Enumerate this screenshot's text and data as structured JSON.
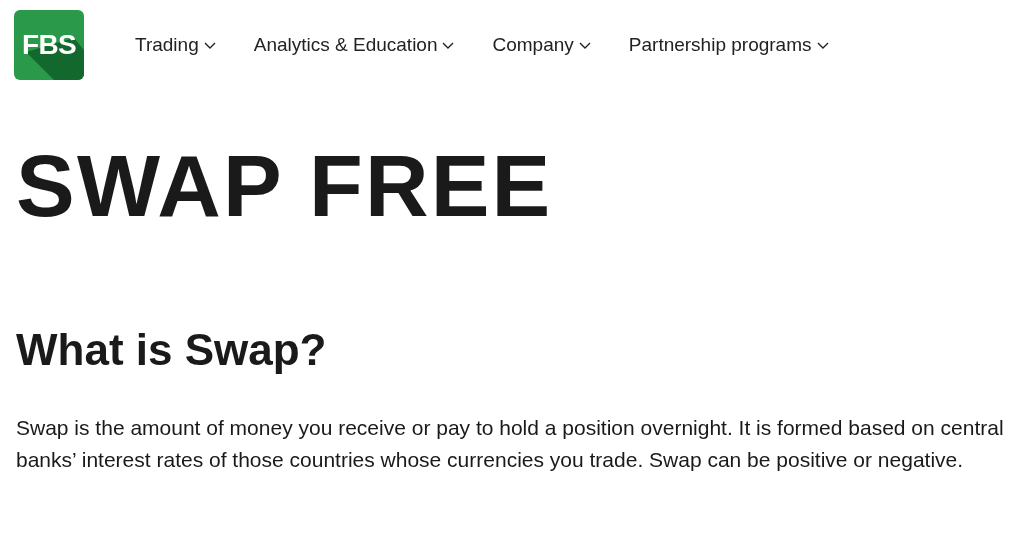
{
  "logo": {
    "text": "FBS"
  },
  "nav": [
    {
      "label": "Trading"
    },
    {
      "label": "Analytics & Education"
    },
    {
      "label": "Company"
    },
    {
      "label": "Partnership programs"
    }
  ],
  "title": "SWAP FREE",
  "section": {
    "heading": "What is Swap?",
    "text": "Swap is the amount of money you receive or pay to hold a position overnight. It is formed based on central banks’ interest rates of those countries whose currencies you trade. Swap can be positive or negative."
  }
}
